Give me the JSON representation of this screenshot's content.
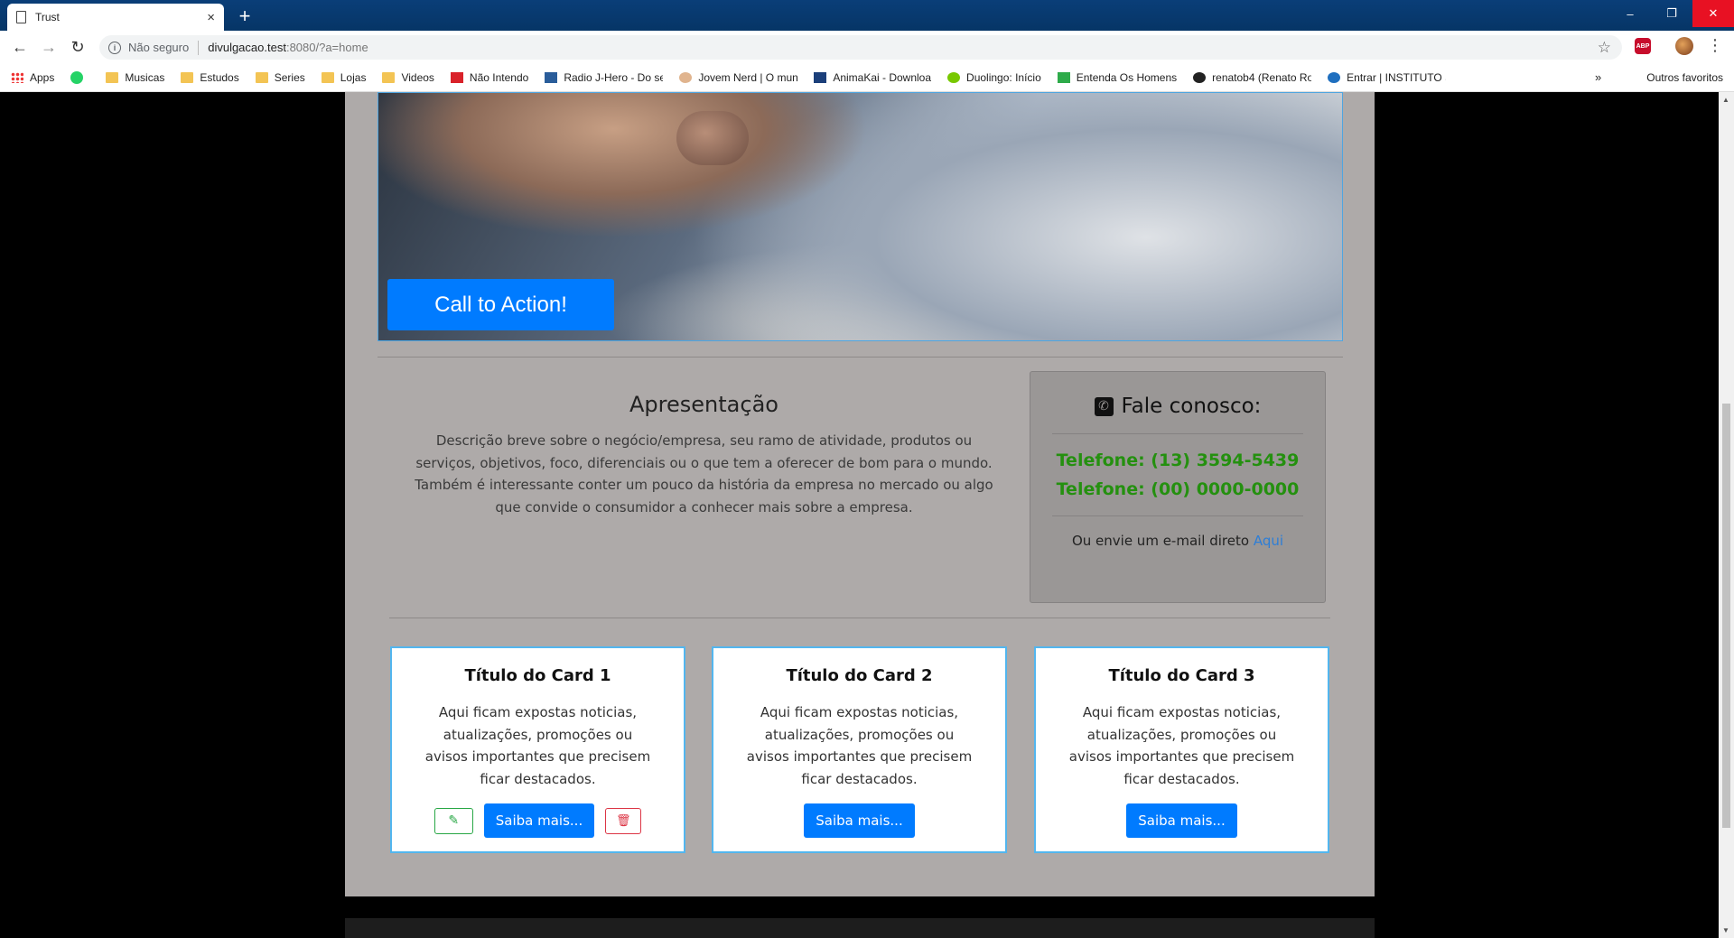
{
  "browser": {
    "tab_title": "Trust",
    "tab_close": "×",
    "new_tab": "+",
    "window_controls": {
      "minimize": "–",
      "restore": "❐",
      "close": "✕"
    },
    "nav": {
      "back": "←",
      "forward": "→",
      "reload": "↻"
    },
    "address": {
      "security_label": "Não seguro",
      "url_host": "divulgacao.test",
      "url_rest": ":8080/?a=home"
    },
    "extension_abp": "ABP",
    "bookmarks": [
      {
        "label": "Apps",
        "icon": "apps-grid-icon"
      },
      {
        "label": "Musicas",
        "icon": "folder-icon"
      },
      {
        "label": "Estudos",
        "icon": "folder-icon"
      },
      {
        "label": "Series",
        "icon": "folder-icon"
      },
      {
        "label": "Lojas",
        "icon": "folder-icon"
      },
      {
        "label": "Videos",
        "icon": "folder-icon"
      },
      {
        "label": "Não Intendo",
        "icon": "site-icon"
      },
      {
        "label": "Radio J-Hero - Do se",
        "icon": "site-icon"
      },
      {
        "label": "Jovem Nerd | O mun",
        "icon": "site-icon"
      },
      {
        "label": "AnimaKai - Downloa",
        "icon": "site-icon"
      },
      {
        "label": "Duolingo: Início",
        "icon": "site-icon"
      },
      {
        "label": "Entenda Os Homens",
        "icon": "site-icon"
      },
      {
        "label": "renatob4 (Renato Ro",
        "icon": "github-icon"
      },
      {
        "label": "Entrar | INSTITUTO SI",
        "icon": "site-icon"
      }
    ],
    "bookmarks_overflow": "»",
    "other_bookmarks": "Outros favoritos",
    "colors": {
      "tabbar": "#063566",
      "close_button": "#e81123"
    }
  },
  "page": {
    "cta_label": "Call to Action!",
    "about": {
      "title": "Apresentação",
      "text": "Descrição breve sobre o negócio/empresa, seu ramo de atividade, produtos ou serviços, objetivos, foco, diferenciais ou o que tem a oferecer de bom para o mundo. Também é interessante conter um pouco da história da empresa no mercado ou algo que convide o consumidor a conhecer mais sobre a empresa."
    },
    "contact": {
      "title": "Fale conosco:",
      "phone1": "Telefone: (13) 3594-5439",
      "phone2": "Telefone: (00) 0000-0000",
      "email_prefix": "Ou envie um e-mail direto",
      "email_link": "Aqui"
    },
    "cards": [
      {
        "title": "Título do Card 1",
        "text": "Aqui ficam expostas noticias, atualizações, promoções ou avisos importantes que precisem ficar destacados.",
        "button": "Saiba mais..."
      },
      {
        "title": "Título do Card 2",
        "text": "Aqui ficam expostas noticias, atualizações, promoções ou avisos importantes que precisem ficar destacados.",
        "button": "Saiba mais..."
      },
      {
        "title": "Título do Card 3",
        "text": "Aqui ficam expostas noticias, atualizações, promoções ou avisos importantes que precisem ficar destacados.",
        "button": "Saiba mais..."
      }
    ],
    "colors": {
      "primary": "#007bff",
      "success": "#28a745",
      "danger": "#dc3545",
      "phone_green": "#24900f",
      "container_bg": "#aeaaa9",
      "card_border": "#52b6ef"
    }
  }
}
